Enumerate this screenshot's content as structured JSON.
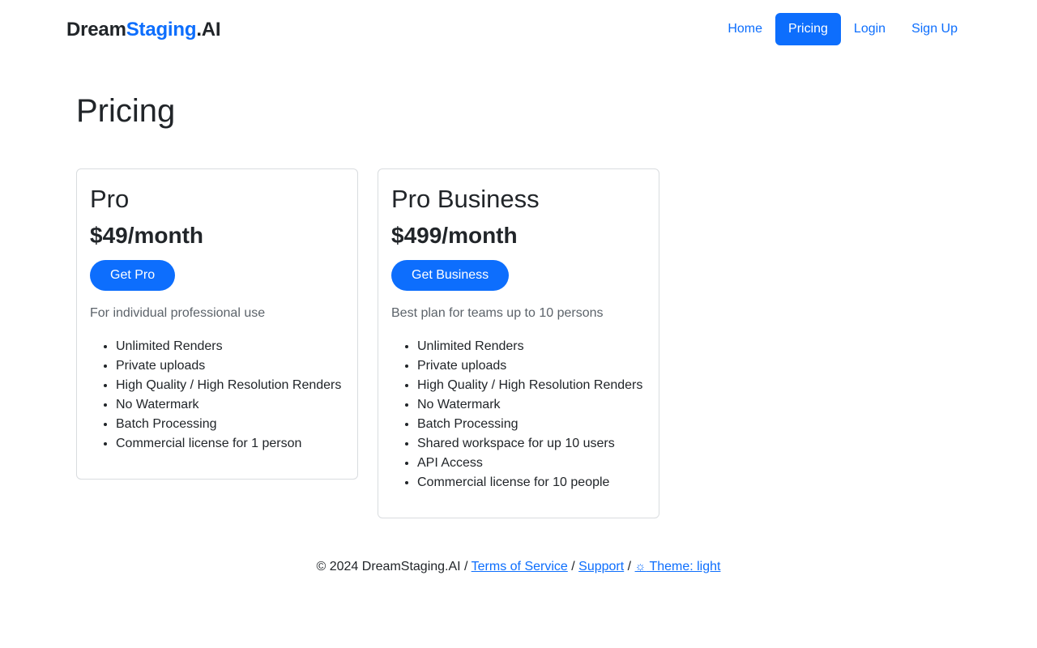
{
  "brand": {
    "part1": "Dream",
    "part2": "Staging",
    "part3": ".AI"
  },
  "nav": {
    "home": "Home",
    "pricing": "Pricing",
    "login": "Login",
    "signup": "Sign Up"
  },
  "colors": {
    "primary": "#0d6efd",
    "text": "#212529",
    "muted": "#5c636a",
    "border": "#d9dcdf"
  },
  "page_title": "Pricing",
  "plans": [
    {
      "name": "Pro",
      "price": "$49/month",
      "cta": "Get Pro",
      "description": "For individual professional use",
      "features": [
        "Unlimited Renders",
        "Private uploads",
        "High Quality / High Resolution Renders",
        "No Watermark",
        "Batch Processing",
        "Commercial license for 1 person"
      ]
    },
    {
      "name": "Pro Business",
      "price": "$499/month",
      "cta": "Get Business",
      "description": "Best plan for teams up to 10 persons",
      "features": [
        "Unlimited Renders",
        "Private uploads",
        "High Quality / High Resolution Renders",
        "No Watermark",
        "Batch Processing",
        "Shared workspace for up 10 users",
        "API Access",
        "Commercial license for 10 people"
      ]
    }
  ],
  "footer": {
    "copyright": "© 2024 DreamStaging.AI",
    "sep": " / ",
    "terms": "Terms of Service",
    "support": "Support",
    "theme_icon": "☼",
    "theme": " Theme: light"
  }
}
